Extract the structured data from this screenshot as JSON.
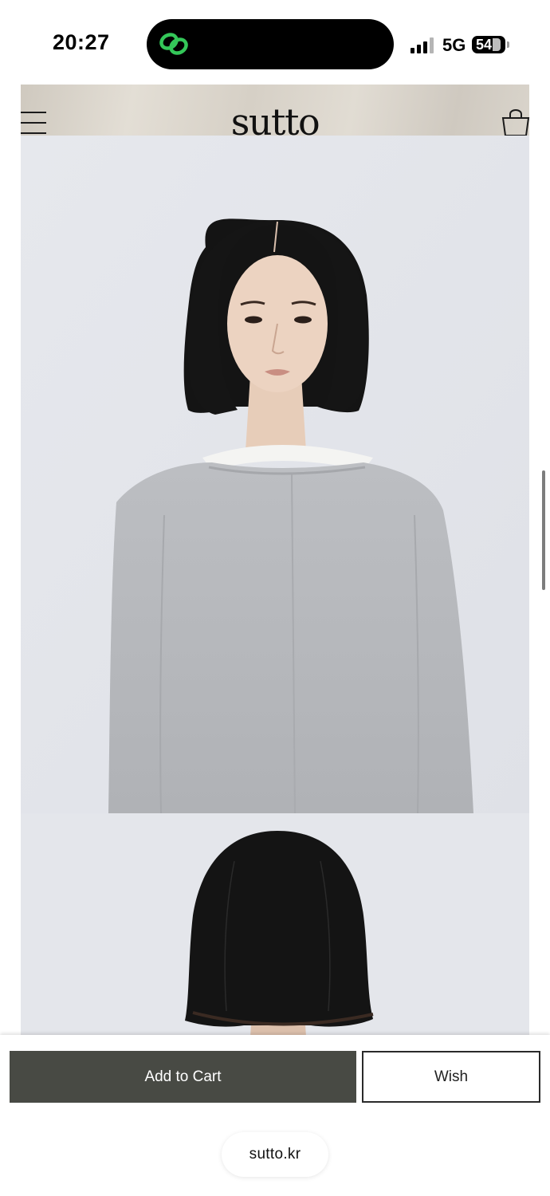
{
  "status_bar": {
    "time": "20:27",
    "network": "5G",
    "battery": "54"
  },
  "header": {
    "brand": "sutto",
    "menu_icon": "hamburger-menu-icon",
    "cart_icon": "shopping-bag-icon"
  },
  "gallery": {
    "images": [
      {
        "name": "model-front-view"
      },
      {
        "name": "model-back-view"
      }
    ]
  },
  "actions": {
    "add_to_cart_label": "Add to Cart",
    "wish_label": "Wish"
  },
  "browser": {
    "url": "sutto.kr"
  },
  "colors": {
    "cart_button": "#484a44",
    "wish_border": "#2a2a2a",
    "photo_background": "#e5e7ec",
    "sweater": "#b6b8bc"
  }
}
